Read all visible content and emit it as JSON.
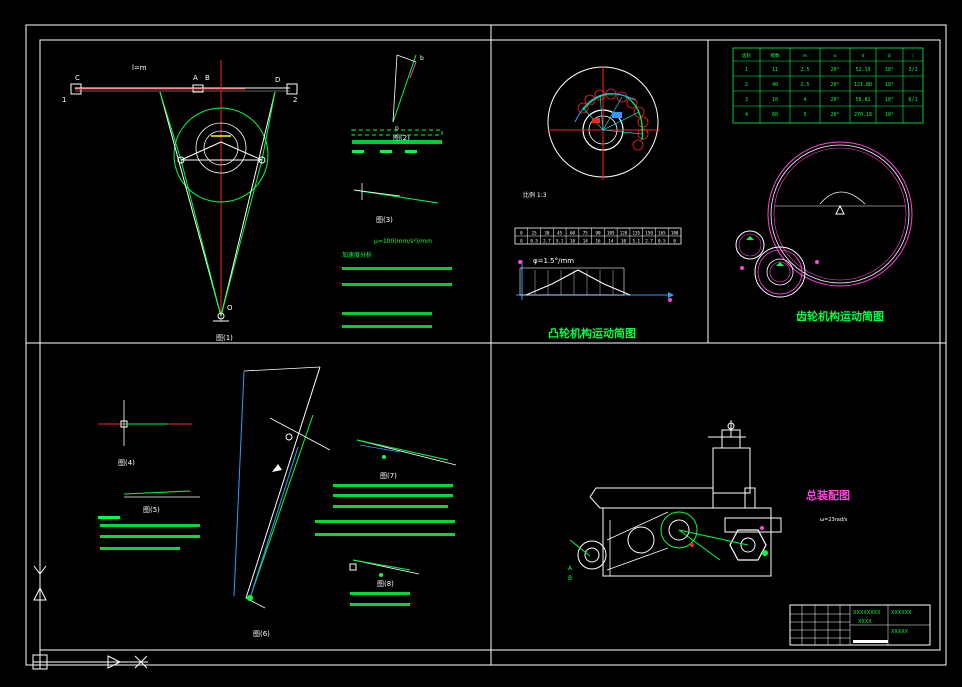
{
  "colors": {
    "background": "#000000",
    "frame": "#ffffff",
    "green": "#00ff40",
    "bright_green": "#33ff66",
    "red": "#ff2020",
    "blue": "#3399ff",
    "cyan": "#00ffff",
    "yellow": "#ffff00",
    "magenta": "#ff44dd",
    "grey": "#bdbdbd"
  },
  "linkage": {
    "label_c": "C",
    "label_a": "A",
    "label_b": "B",
    "label_d": "D",
    "label_o": "O",
    "label_1": "1",
    "label_2": "2",
    "scale_note": "l=m",
    "fig_label": "图(1)",
    "bottom_label": "C₂"
  },
  "velocity_fig": {
    "fig_label": "图(2)",
    "p": "p",
    "b": "b"
  },
  "accel_fig": {
    "fig_label": "图(3)",
    "eq1": "μ=100(mm/s²)/mm",
    "head": "加速度分析"
  },
  "cam": {
    "title": "凸轮机构运动简图",
    "scale": "比例 1:3",
    "phi_label": "φ=1.5°/mm",
    "table_row1": [
      "0",
      "15",
      "30",
      "45",
      "60",
      "75",
      "90",
      "105",
      "120",
      "135",
      "150",
      "165",
      "180"
    ],
    "table_row2": [
      "0",
      "0.5",
      "2.7",
      "5.1",
      "10",
      "14",
      "16",
      "14",
      "10",
      "5.1",
      "2.7",
      "0.5",
      "0"
    ]
  },
  "gear": {
    "title": "齿轮机构运动简图",
    "table_head": [
      "齿轮",
      "模数",
      "m",
      "α",
      "d",
      "β",
      "i"
    ],
    "rows": [
      [
        "1",
        "11",
        "2.5",
        "20°",
        "52.19",
        "18°",
        "3/1"
      ],
      [
        "2",
        "40",
        "2.5",
        "20°",
        "121.88",
        "18°",
        ""
      ],
      [
        "3",
        "10",
        "4",
        "20°",
        "56.81",
        "18°",
        "6/1"
      ],
      [
        "4",
        "60",
        "5",
        "20°",
        "270.18",
        "18°",
        ""
      ]
    ]
  },
  "assembly": {
    "title": "总装配图",
    "note": "ω=23rad/s",
    "left_label": "A",
    "left_label2": "B"
  },
  "lower_left": {
    "fig4": "图(4)",
    "fig5": "图(5)",
    "fig6": "图(6)",
    "fig7": "图(7)",
    "fig8": "图(8)"
  },
  "title_block": {
    "r1": "XXXXXXXX",
    "r2": "XXXX",
    "school": "XXXXXX",
    "drawing": "XXXXX"
  }
}
